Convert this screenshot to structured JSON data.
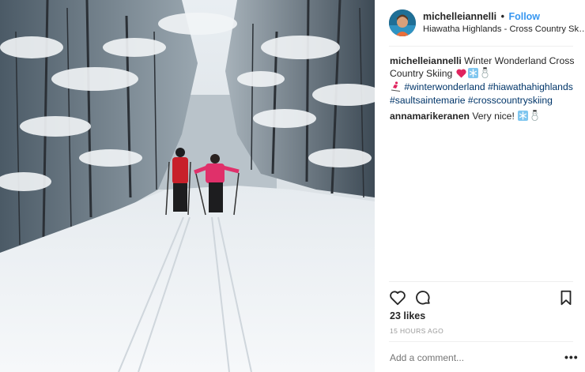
{
  "post": {
    "photo_alt": "",
    "header": {
      "username": "michelleiannelli",
      "separator": "•",
      "follow_label": "Follow",
      "location": "Hiawatha Highlands - Cross Country Skiing"
    },
    "caption": {
      "username": "michelleiannelli",
      "text": "Winter Wonderland Cross Country Skiing",
      "hashtags": [
        "#winterwonderland",
        "#hiawathahighlands",
        "#saultsaintemarie",
        "#crosscountryskiing"
      ]
    },
    "comments": [
      {
        "username": "annamarikeranen",
        "text": "Very nice!"
      }
    ],
    "likes": "23 likes",
    "timestamp": "15 HOURS AGO",
    "add_comment_placeholder": "Add a comment...",
    "more_label": "•••"
  },
  "icons": {
    "heart": "heart-outline-icon",
    "comment": "comment-bubble-icon",
    "bookmark": "bookmark-outline-icon",
    "emoji_heart": "red-heart-emoji",
    "emoji_snowflake": "snowflake-emoji",
    "emoji_snowman": "snowman-emoji",
    "emoji_skier": "skier-emoji"
  },
  "colors": {
    "link": "#3897f0",
    "hashtag": "#003569",
    "muted": "#999999",
    "text": "#262626",
    "heart": "#e0245e"
  }
}
